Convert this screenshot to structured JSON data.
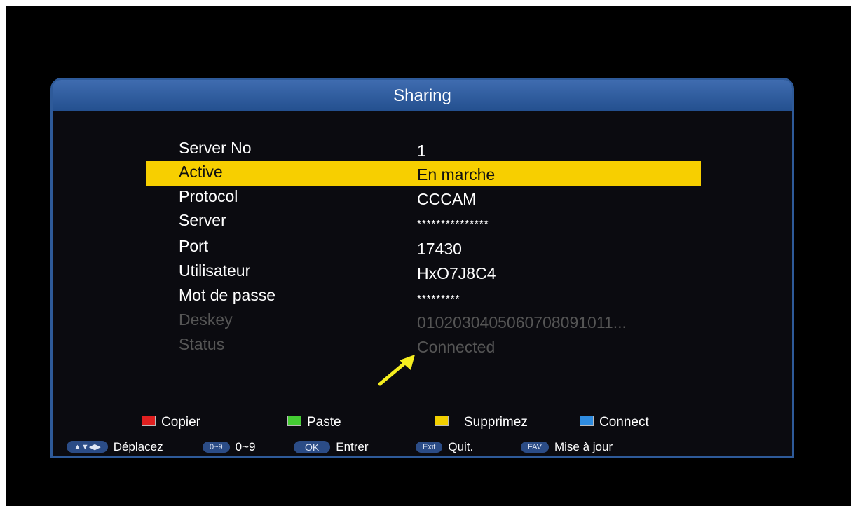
{
  "dialog": {
    "title": "Sharing"
  },
  "fields": [
    {
      "label": "Server No",
      "value": "1"
    },
    {
      "label": "Active",
      "value": "En marche"
    },
    {
      "label": "Protocol",
      "value": "CCCAM"
    },
    {
      "label": "Server",
      "value": "***************"
    },
    {
      "label": "Port",
      "value": "17430"
    },
    {
      "label": "Utilisateur",
      "value": "HxO7J8C4"
    },
    {
      "label": "Mot de passe",
      "value": "*********"
    },
    {
      "label": "Deskey",
      "value": "0102030405060708091011..."
    },
    {
      "label": "Status",
      "value": "Connected"
    }
  ],
  "color_keys": [
    {
      "color": "#e02020",
      "label": "Copier"
    },
    {
      "color": "#44cc33",
      "label": "Paste"
    },
    {
      "color": "#f2d000",
      "label": "Supprimez"
    },
    {
      "color": "#2f8ce0",
      "label": "Connect"
    }
  ],
  "nav_hints": [
    {
      "key": "▲▼◀▶",
      "label": "Déplacez"
    },
    {
      "key": "0~9",
      "label": "0~9"
    },
    {
      "key": "OK",
      "label": "Entrer"
    },
    {
      "key": "Exit",
      "label": "Quit."
    },
    {
      "key": "FAV",
      "label": "Mise à jour"
    }
  ],
  "colors": {
    "highlight": "#f7cf00",
    "title_bar": "#2e5a99",
    "annotation_arrow": "#f5ee1f"
  }
}
